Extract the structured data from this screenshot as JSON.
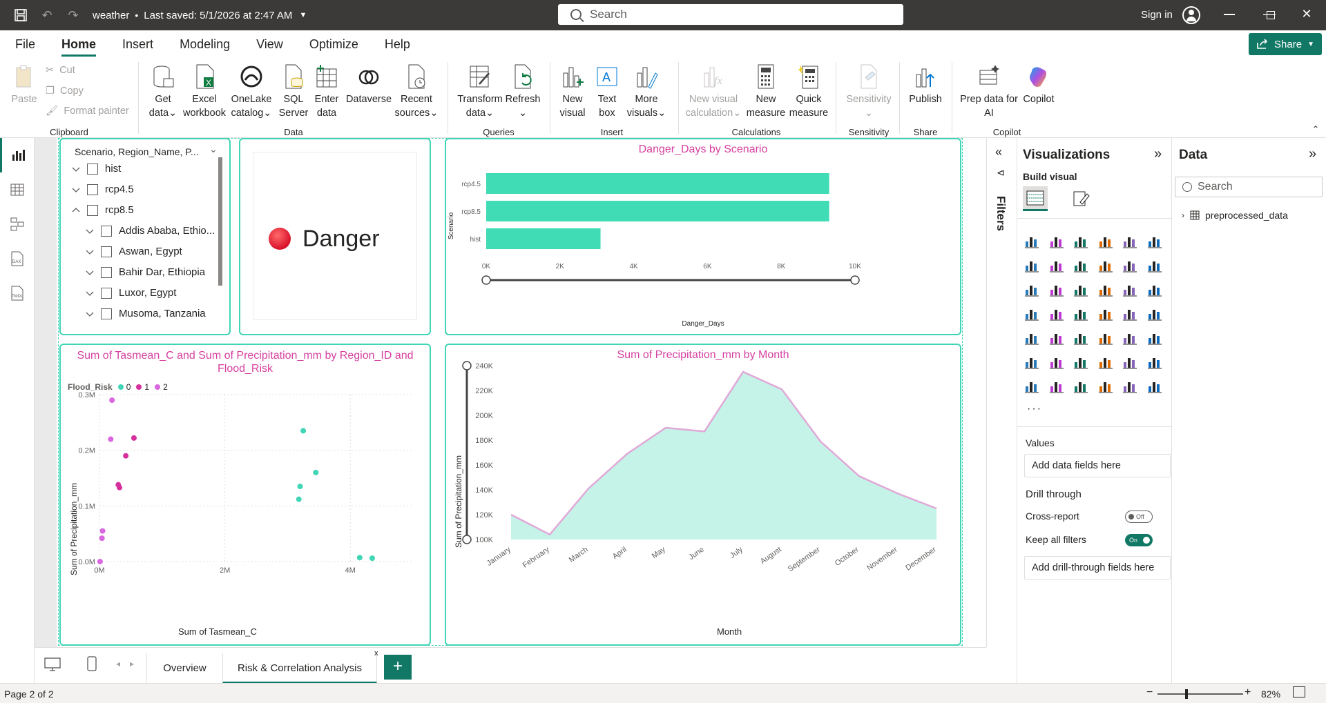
{
  "titlebar": {
    "doc_title": "weather",
    "saved": "Last saved: 5/1/2026 at 2:47 AM",
    "search_placeholder": "Search",
    "signin": "Sign in"
  },
  "tabs": [
    "File",
    "Home",
    "Insert",
    "Modeling",
    "View",
    "Optimize",
    "Help"
  ],
  "share_label": "Share",
  "ribbon": {
    "paste": "Paste",
    "cut": "Cut",
    "copy": "Copy",
    "format_painter": "Format painter",
    "clipboard": "Clipboard",
    "get_data": [
      "Get",
      "data"
    ],
    "excel": [
      "Excel",
      "workbook"
    ],
    "onelake": [
      "OneLake",
      "catalog"
    ],
    "sql": [
      "SQL",
      "Server"
    ],
    "enter_data": [
      "Enter",
      "data"
    ],
    "dataverse": "Dataverse",
    "recent": [
      "Recent",
      "sources"
    ],
    "data_group": "Data",
    "transform": [
      "Transform",
      "data"
    ],
    "refresh": "Refresh",
    "queries": "Queries",
    "new_visual": [
      "New",
      "visual"
    ],
    "text_box": [
      "Text",
      "box"
    ],
    "more_visuals": [
      "More",
      "visuals"
    ],
    "insert_group": "Insert",
    "new_visual_calc": [
      "New visual",
      "calculation"
    ],
    "new_measure": [
      "New",
      "measure"
    ],
    "quick_measure": [
      "Quick",
      "measure"
    ],
    "calculations": "Calculations",
    "sensitivity_btn": "Sensitivity",
    "sensitivity": "Sensitivity",
    "publish": "Publish",
    "share_group": "Share",
    "prep_data": [
      "Prep data for",
      "AI"
    ],
    "copilot_btn": "Copilot",
    "copilot": "Copilot"
  },
  "slicer": {
    "header": "Scenario, Region_Name, P...",
    "items": [
      "hist",
      "rcp4.5",
      "rcp8.5"
    ],
    "subitems": [
      "Addis Ababa, Ethio...",
      "Aswan, Egypt",
      "Bahir Dar, Ethiopia",
      "Luxor, Egypt",
      "Musoma, Tanzania"
    ]
  },
  "card": {
    "value": "Danger"
  },
  "bar_chart": {
    "title": "Danger_Days by Scenario",
    "ylabel": "Scenario",
    "xlabel": "Danger_Days",
    "color": "#3fdcb5"
  },
  "scatter_chart": {
    "title": "Sum of Tasmean_C and Sum of Precipitation_mm by Region_ID and Flood_Risk",
    "legend_title": "Flood_Risk",
    "xlabel": "Sum of Tasmean_C",
    "ylabel": "Sum of Precipitation_mm"
  },
  "area_chart": {
    "title": "Sum of Precipitation_mm by Month",
    "xlabel": "Month",
    "ylabel": "Sum of Precipitation_mm"
  },
  "chart_data": [
    {
      "type": "bar",
      "categories": [
        "rcp4.5",
        "rcp8.5",
        "hist"
      ],
      "values": [
        9300,
        9300,
        3100
      ],
      "xlim": [
        0,
        10000
      ],
      "xticks": [
        "0K",
        "2K",
        "4K",
        "6K",
        "8K",
        "10K"
      ]
    },
    {
      "type": "scatter",
      "series": [
        {
          "name": "0",
          "color": "#3fd5b5",
          "points": [
            [
              3250000,
              235000
            ],
            [
              3450000,
              160000
            ],
            [
              3200000,
              135000
            ],
            [
              3180000,
              112000
            ],
            [
              4150000,
              7000
            ],
            [
              4350000,
              6000
            ]
          ]
        },
        {
          "name": "1",
          "color": "#d6309c",
          "points": [
            [
              550000,
              222000
            ],
            [
              420000,
              190000
            ],
            [
              300000,
              138000
            ],
            [
              320000,
              133000
            ]
          ]
        },
        {
          "name": "2",
          "color": "#d968e0",
          "points": [
            [
              200000,
              290000
            ],
            [
              180000,
              220000
            ],
            [
              50000,
              55000
            ],
            [
              40000,
              42000
            ],
            [
              10000,
              0
            ]
          ]
        }
      ],
      "xlim": [
        0,
        5000000
      ],
      "ylim": [
        0,
        300000
      ],
      "xticks": [
        "0M",
        "2M",
        "4M"
      ],
      "yticks": [
        "0.0M",
        "0.1M",
        "0.2M",
        "0.3M"
      ]
    },
    {
      "type": "area",
      "categories": [
        "January",
        "February",
        "March",
        "April",
        "May",
        "June",
        "July",
        "August",
        "September",
        "October",
        "November",
        "December"
      ],
      "values": [
        120000,
        104000,
        141000,
        169000,
        190000,
        187000,
        235000,
        221000,
        179000,
        151000,
        137000,
        125000
      ],
      "ylim": [
        100000,
        240000
      ],
      "yticks": [
        "100K",
        "120K",
        "140K",
        "160K",
        "180K",
        "200K",
        "220K",
        "240K"
      ]
    }
  ],
  "filters_label": "Filters",
  "viz_pane": {
    "title": "Visualizations",
    "build": "Build visual",
    "values": "Values",
    "add_data": "Add data fields here",
    "drill": "Drill through",
    "cross_report": "Cross-report",
    "cross_state": "Off",
    "keep_filters": "Keep all filters",
    "keep_state": "On",
    "add_drill": "Add drill-through fields here"
  },
  "data_pane": {
    "title": "Data",
    "search": "Search",
    "table": "preprocessed_data"
  },
  "page_tabs": [
    "Overview",
    "Risk & Correlation Analysis"
  ],
  "status": {
    "page": "Page 2 of 2",
    "zoom": "82%"
  }
}
